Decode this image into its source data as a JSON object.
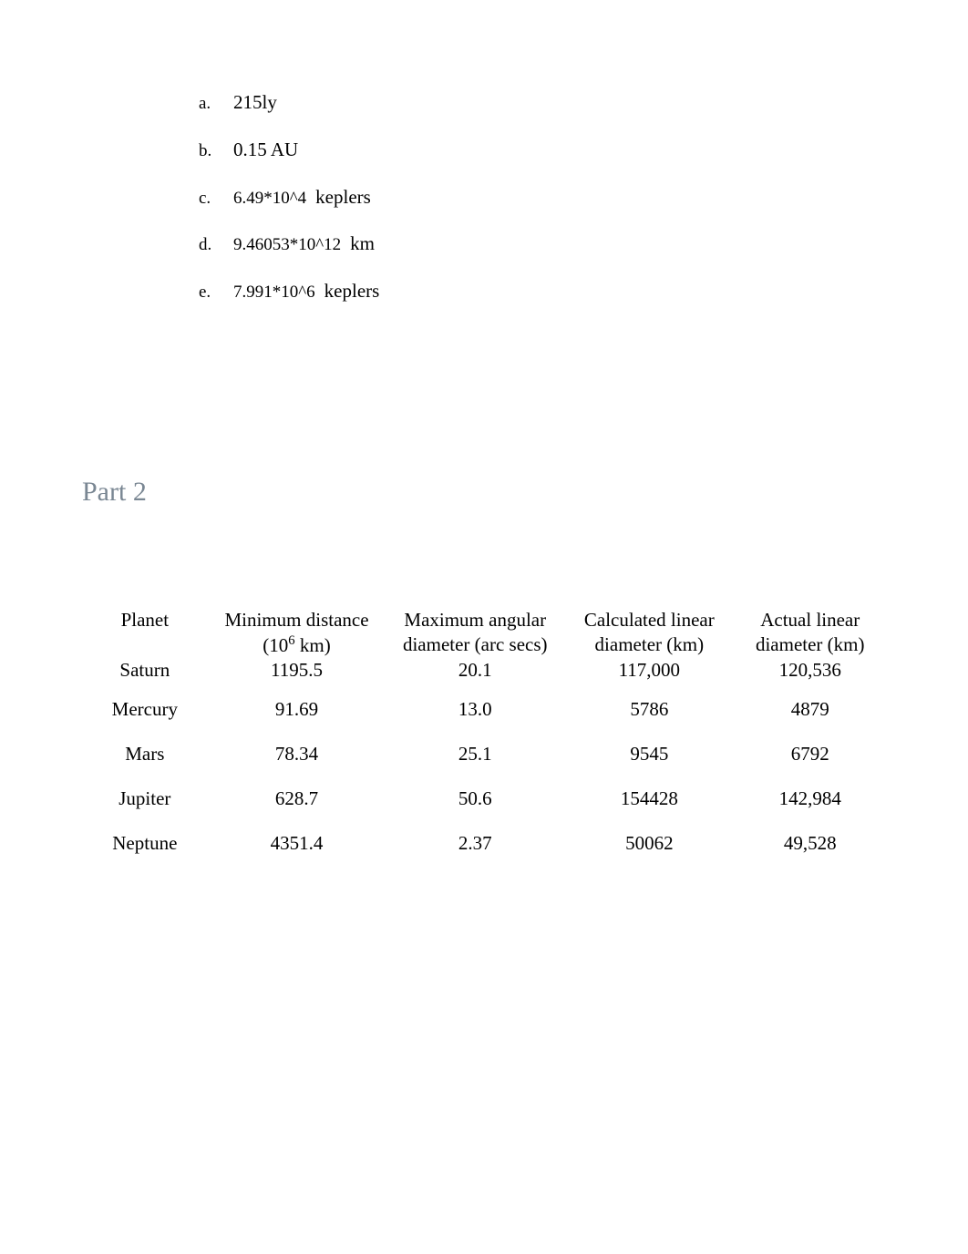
{
  "answers": {
    "a": {
      "marker": "a.",
      "value": "215ly"
    },
    "b": {
      "marker": "b.",
      "value": "0.15 AU"
    },
    "c": {
      "marker": "c.",
      "small": "6.49*10^4",
      "unit": "keplers"
    },
    "d": {
      "marker": "d.",
      "small": "9.46053*10^12",
      "unit": "km"
    },
    "e": {
      "marker": "e.",
      "small": "7.991*10^6",
      "unit": "keplers"
    }
  },
  "section_heading": "Part 2",
  "table": {
    "header": {
      "planet": "Planet",
      "min1": "Minimum distance",
      "min2_pre": "(10",
      "min2_sup": "6",
      "min2_post": " km)",
      "max1": "Maximum angular",
      "max2": "diameter (arc secs)",
      "calc1": "Calculated linear",
      "calc2": "diameter (km)",
      "act1": "Actual linear",
      "act2": "diameter (km)"
    },
    "rows": [
      {
        "planet": "Saturn",
        "min": "1195.5",
        "max": "20.1",
        "calc": "117,000",
        "act": "120,536"
      },
      {
        "planet": "Mercury",
        "min": "91.69",
        "max": "13.0",
        "calc": "5786",
        "act": "4879"
      },
      {
        "planet": "Mars",
        "min": "78.34",
        "max": "25.1",
        "calc": "9545",
        "act": "6792"
      },
      {
        "planet": "Jupiter",
        "min": "628.7",
        "max": "50.6",
        "calc": "154428",
        "act": "142,984"
      },
      {
        "planet": "Neptune",
        "min": "4351.4",
        "max": "2.37",
        "calc": "50062",
        "act": "49,528"
      }
    ]
  },
  "chart_data": {
    "type": "table",
    "title": "Part 2",
    "columns": [
      "Planet",
      "Minimum distance (10^6 km)",
      "Maximum angular diameter (arc secs)",
      "Calculated linear diameter (km)",
      "Actual linear diameter (km)"
    ],
    "rows": [
      [
        "Saturn",
        1195.5,
        20.1,
        117000,
        120536
      ],
      [
        "Mercury",
        91.69,
        13.0,
        5786,
        4879
      ],
      [
        "Mars",
        78.34,
        25.1,
        9545,
        6792
      ],
      [
        "Jupiter",
        628.7,
        50.6,
        154428,
        142984
      ],
      [
        "Neptune",
        4351.4,
        2.37,
        50062,
        49528
      ]
    ]
  }
}
